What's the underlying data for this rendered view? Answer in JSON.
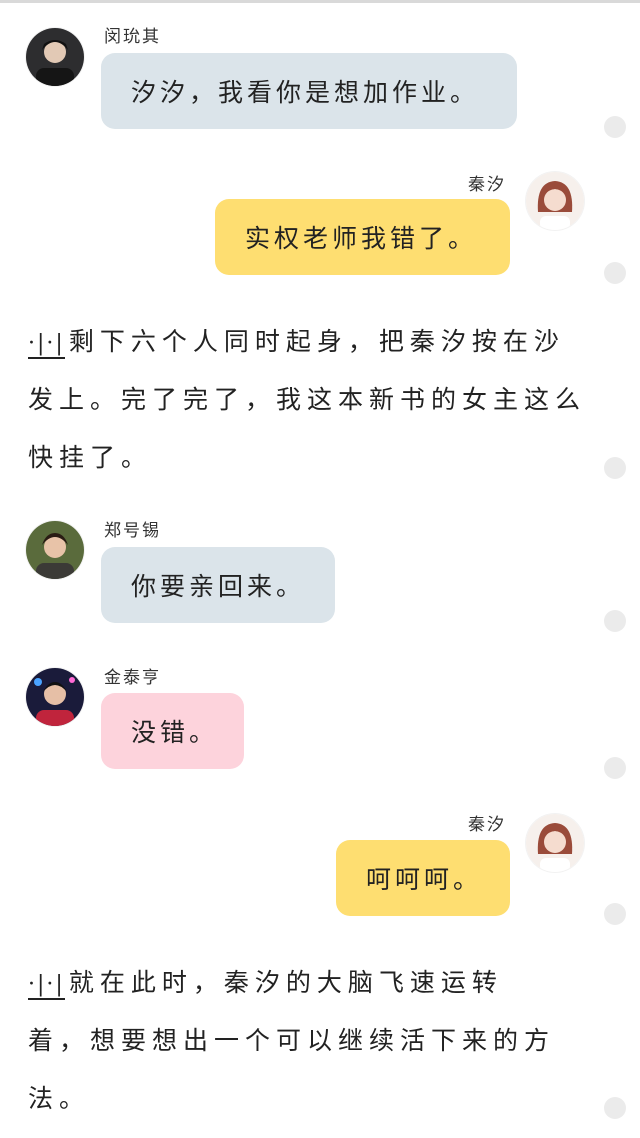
{
  "colors": {
    "bubble_other": "#dbe4ea",
    "bubble_self": "#fede71",
    "bubble_pink": "#fdd3dc",
    "dot": "#ebebeb"
  },
  "messages": [
    {
      "sender": "闵玧其",
      "text": "汐汐，我看你是想加作业。",
      "side": "left",
      "avatar_icon": "avatar-man-icon"
    },
    {
      "sender": "秦汐",
      "text": "实权老师我错了。",
      "side": "right",
      "avatar_icon": "avatar-woman-icon"
    },
    {
      "sender": "郑号锡",
      "text": "你要亲回来。",
      "side": "left",
      "avatar_icon": "avatar-man-icon"
    },
    {
      "sender": "金泰亨",
      "text": "没错。",
      "side": "left",
      "avatar_icon": "avatar-man-icon"
    },
    {
      "sender": "秦汐",
      "text": "呵呵呵。",
      "side": "right",
      "avatar_icon": "avatar-woman-icon"
    }
  ],
  "narrations": [
    {
      "marker": "·|·|",
      "lines": [
        "剩下六个人同时起身，把秦汐按在沙",
        "发上。完了完了，我这本新书的女主这么",
        "快挂了。"
      ]
    },
    {
      "marker": "·|·|",
      "lines": [
        "就在此时，秦汐的大脑飞速运转",
        "着，想要想出一个可以继续活下来的方",
        "法。"
      ]
    }
  ]
}
